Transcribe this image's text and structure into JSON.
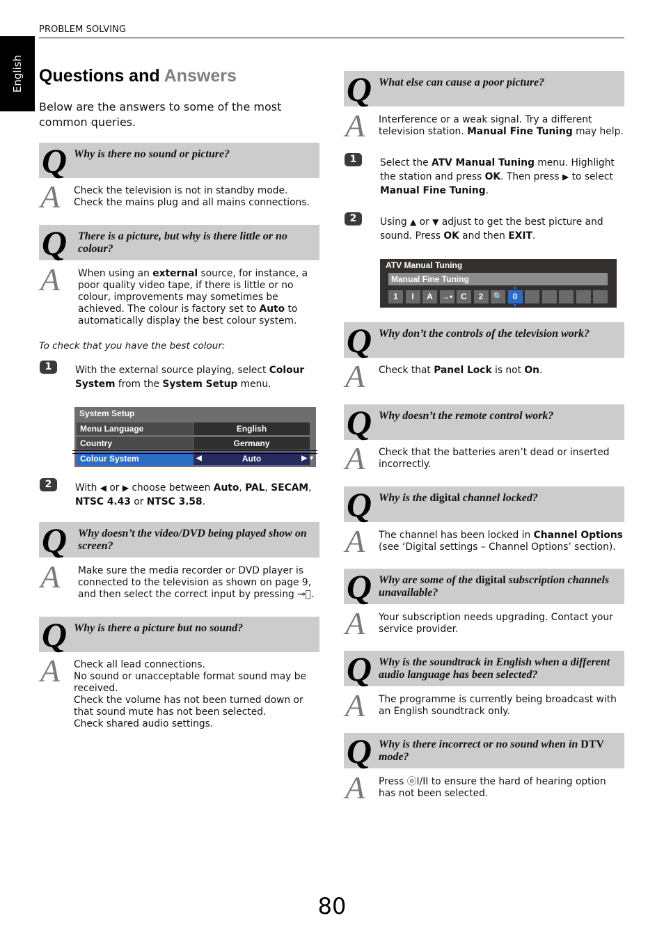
{
  "header": {
    "section": "PROBLEM SOLVING",
    "language_tab": "English"
  },
  "title": {
    "main": "Questions and",
    "accent": "Answers"
  },
  "intro": "Below are the answers to some of the most common queries.",
  "q_letter": "Q",
  "a_letter": "A",
  "left": {
    "qa1": {
      "question": "Why is there no sound or picture?",
      "answer": "Check the television is not in standby mode. Check the mains plug and all mains connections."
    },
    "qa2": {
      "question": "There is a picture, but why is there little or no colour?",
      "answer": {
        "p1": "When using an ",
        "b1": "external",
        "p2": " source, for instance, a poor quality video tape, if there is little or no colour, improvements may sometimes be achieved. The colour is factory set to ",
        "b2": "Auto",
        "p3": " to automatically display the best colour system."
      },
      "note": "To check that you have the best colour:",
      "step1": {
        "num": "1",
        "p1": "With the external source playing, select ",
        "b1": "Colour System",
        "p2": " from the ",
        "b2": "System Setup",
        "p3": " menu."
      },
      "menu": {
        "title": "System Setup",
        "rows": [
          {
            "label": "Menu Language",
            "value": "English"
          },
          {
            "label": "Country",
            "value": "Germany"
          },
          {
            "label": "Colour System",
            "value": "Auto",
            "selected": true
          }
        ]
      },
      "step2": {
        "num": "2",
        "p1": "With ",
        "p2": " or ",
        "p3": " choose between ",
        "opts": [
          "Auto",
          "PAL",
          "SECAM",
          "NTSC 4.43",
          "NTSC 3.58"
        ],
        "or": " or "
      }
    },
    "qa3": {
      "question": "Why doesn’t the video/DVD being played show on screen?",
      "answer": "Make sure the media recorder or DVD player is connected to the television as shown on page 9, and then select the correct input by pressing"
    },
    "qa4": {
      "question": "Why is there a picture but no sound?",
      "answer_lines": [
        "Check all lead connections.",
        "No sound or unacceptable format sound may be received.",
        "Check the volume has not been turned down or that sound mute has not been selected.",
        "Check shared audio settings."
      ]
    }
  },
  "right": {
    "qa5": {
      "question": "What else can cause a poor picture?",
      "answer": {
        "p1": "Interference or a weak signal. Try a different television station. ",
        "b1": "Manual Fine Tuning",
        "p2": " may help."
      },
      "step1": {
        "num": "1",
        "p1": "Select the ",
        "b1": "ATV Manual Tuning",
        "p2": " menu. Highlight the station and press ",
        "b2": "OK",
        "p3": ". Then press ",
        "p4": " to select ",
        "b3": "Manual Fine Tuning",
        "p5": "."
      },
      "step2": {
        "num": "2",
        "p1": "Using ",
        "p2": " or ",
        "p3": " adjust to get the best picture and sound. Press ",
        "b1": "OK",
        "p4": " and then ",
        "b2": "EXIT",
        "p5": "."
      },
      "menu": {
        "title": "ATV Manual Tuning",
        "subtitle": "Manual Fine Tuning",
        "cells": [
          "1",
          "I",
          "A",
          "→•",
          "C",
          "2",
          "🔍",
          "0",
          "",
          "",
          "",
          "",
          ""
        ],
        "active_index": 7
      }
    },
    "qa6": {
      "question": "Why don’t the controls of the television work?",
      "answer": {
        "p1": "Check that ",
        "b1": "Panel Lock",
        "p2": " is not ",
        "b2": "On",
        "p3": "."
      }
    },
    "qa7": {
      "question": "Why doesn’t the remote control work?",
      "answer": "Check that the batteries aren’t dead or inserted incorrectly."
    },
    "qa8": {
      "question": {
        "p1": "Why is the ",
        "up": "digital",
        "p2": " channel locked?"
      },
      "answer": {
        "p1": "The channel has been locked in ",
        "b1": "Channel Options",
        "p2": " (see ‘Digital settings – Channel Options’ section)."
      }
    },
    "qa9": {
      "question": {
        "p1": "Why are some of the ",
        "up": "digital",
        "p2": " subscription channels unavailable?"
      },
      "answer": "Your subscription needs upgrading. Contact your service provider."
    },
    "qa10": {
      "question": "Why is the soundtrack in English when a different audio language has been selected?",
      "answer": "The programme is currently being broadcast with an English soundtrack only."
    },
    "qa11": {
      "question": {
        "p1": "Why is there incorrect or no sound when in ",
        "up": "DTV",
        "p2": " mode?"
      },
      "answer": {
        "p1": "Press ",
        "icon": "ⓞI/II",
        "p2": " to ensure the hard of hearing option has not been selected."
      }
    }
  },
  "page_number": "80"
}
